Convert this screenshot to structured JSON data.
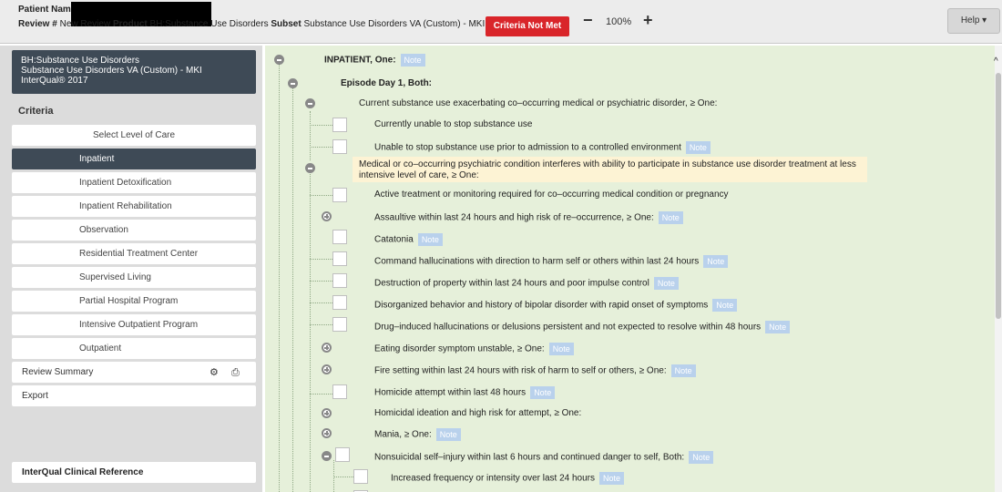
{
  "header": {
    "patient_label": "Patient Name/ID",
    "review_label": "Review #",
    "review_value": "New Review",
    "product_label": "Product",
    "product_value": "BH:Substance Use Disorders",
    "subset_label": "Subset",
    "subset_value": "Substance Use Disorders VA (Custom) - MKI",
    "status_button": "Criteria Not Met",
    "zoom_minus": "−",
    "zoom_level": "100%",
    "zoom_plus": "+",
    "help": "Help ▾",
    "status_color": "#d9252a"
  },
  "sidebar": {
    "info_line1": "BH:Substance Use Disorders",
    "info_line2": "Substance Use Disorders VA (Custom) - MKI",
    "info_line3": "InterQual® 2017",
    "criteria_heading": "Criteria",
    "select_level": "Select Level of Care",
    "levels": [
      "Inpatient",
      "Inpatient Detoxification",
      "Inpatient Rehabilitation",
      "Observation",
      "Residential Treatment Center",
      "Supervised Living",
      "Partial Hospital Program",
      "Intensive Outpatient Program",
      "Outpatient"
    ],
    "review_summary": "Review Summary",
    "gear_icon": "gear-icon",
    "printer_icon": "printer-icon",
    "export": "Export",
    "clinical_reference": "InterQual Clinical Reference"
  },
  "tree": {
    "note": "Note",
    "root": "INPATIENT, One:",
    "episode": "Episode Day 1, Both:",
    "group1": "Current substance use exacerbating co–occurring medical or psychiatric disorder, ≥ One:",
    "g1_items": [
      "Currently unable to stop substance use",
      "Unable to stop substance use prior to admission to a controlled environment"
    ],
    "group2_line1": "Medical or co–occurring psychiatric condition interferes with ability to participate in substance use disorder treatment at less",
    "group2_line2": "intensive level of care, ≥ One:",
    "g2_items": [
      "Active treatment or monitoring required for co–occurring medical condition or pregnancy",
      "Assaultive within last 24 hours and high risk of re–occurrence, ≥ One:",
      "Catatonia",
      "Command hallucinations with direction to harm self or others within last 24 hours",
      "Destruction of property within last 24 hours and poor impulse control",
      "Disorganized behavior and history of bipolar disorder with rapid onset of symptoms",
      "Drug–induced hallucinations or delusions persistent and not expected to resolve within 48 hours",
      "Eating disorder symptom unstable, ≥ One:",
      "Fire setting within last 24 hours with risk of harm to self or others, ≥ One:",
      "Homicide attempt within last 48 hours",
      "Homicidal ideation and high risk for attempt, ≥ One:",
      "Mania, ≥ One:",
      "Nonsuicidal self–injury within last 6 hours and continued danger to self, Both:"
    ],
    "sub_item": "Increased frequency or intensity over last 24 hours"
  }
}
